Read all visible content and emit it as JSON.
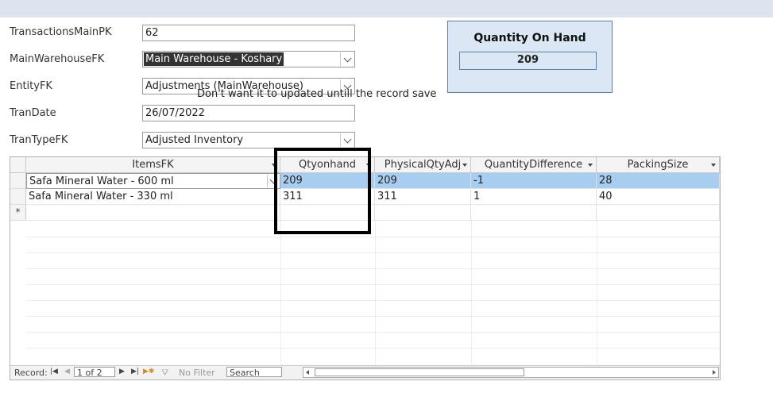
{
  "form": {
    "fields": [
      {
        "label": "TransactionsMainPK",
        "value": "62"
      },
      {
        "label": "MainWarehouseFK",
        "value": "Main Warehouse - Koshary"
      },
      {
        "label": "EntityFK",
        "value": "Adjustments (MainWarehouse)"
      },
      {
        "label": "TranDate",
        "value": "26/07/2022"
      },
      {
        "label": "TranTypeFK",
        "value": "Adjusted Inventory"
      }
    ]
  },
  "quantity_panel": {
    "title": "Quantity On Hand",
    "value": "209"
  },
  "grid": {
    "columns": [
      "ItemsFK",
      "Qtyonhand",
      "PhysicalQtyAdj",
      "QuantityDifference",
      "PackingSize"
    ],
    "rows": [
      [
        "Safa Mineral Water - 600 ml",
        "209",
        "209",
        "-1",
        "28"
      ],
      [
        "Safa Mineral Water - 330 ml",
        "311",
        "311",
        "1",
        "40"
      ]
    ],
    "new_row_marker": "*"
  },
  "annotation": "Don't want it to updated untill the record save",
  "nav": {
    "record_label": "Record:",
    "position": "1 of 2",
    "filter_label": "No Filter",
    "search_label": "Search"
  }
}
